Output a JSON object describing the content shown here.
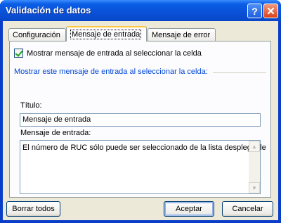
{
  "window": {
    "title": "Validación de datos"
  },
  "titlebar": {
    "help_glyph": "?",
    "close_glyph": "✕"
  },
  "tabs": [
    {
      "label": "Configuración"
    },
    {
      "label": "Mensaje de entrada",
      "active": true
    },
    {
      "label": "Mensaje de error"
    }
  ],
  "panel": {
    "show_message_checkbox": {
      "label": "Mostrar mensaje de entrada al seleccionar la celda",
      "checked": true
    },
    "group_label": "Mostrar este mensaje de entrada al seleccionar la celda:",
    "title_label": "Título:",
    "title_value": "Mensaje de entrada",
    "message_label": "Mensaje de entrada:",
    "message_value": "El número de RUC sólo puede ser seleccionado de la lista desplegable"
  },
  "buttons": {
    "clear_all": "Borrar todos",
    "ok": "Aceptar",
    "cancel": "Cancelar"
  },
  "icons": {
    "help": "help-icon",
    "close": "close-icon",
    "check": "checkmark-icon",
    "scroll_up": "scroll-up-arrow-icon",
    "scroll_down": "scroll-down-arrow-icon"
  },
  "colors": {
    "titlebar": "#0a52d9",
    "dialog_bg": "#ece9d8",
    "group_label": "#0046d5",
    "active_tab_accent": "#ffc83c",
    "close_button": "#d8431c"
  }
}
